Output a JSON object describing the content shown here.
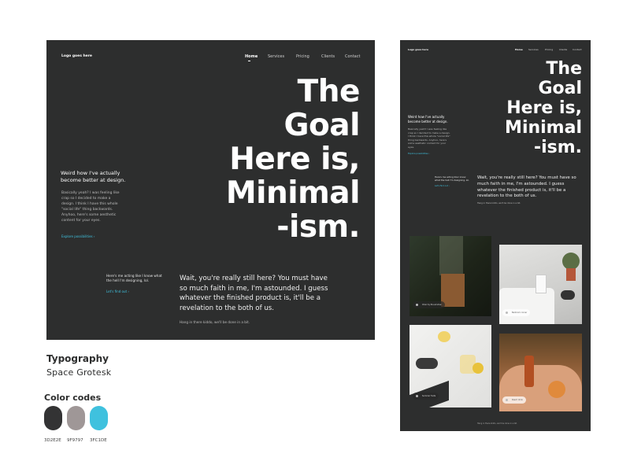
{
  "desktop": {
    "logo": "Logo goes here",
    "nav": [
      "Home",
      "Services",
      "Pricing",
      "Clients",
      "Contact"
    ],
    "hero": [
      "The",
      "Goal",
      "Here is,",
      "Minimal",
      "-ism."
    ],
    "lead": "Weird how I've actually become better at design.",
    "body": "Basically yeah? I was feeling like crap so I decided to make a design. I think I have this whole \"social life\" thing backwards. Anyhoo, here's some aesthetic content for your eyes.",
    "link1": "Explore possibilities ›",
    "small": "Here's me acting like I know what the hell I'm designing, lol.",
    "link2": "Let's find out ›",
    "wait": "Wait, you're really still here? You must have so much faith in me, I'm astounded. I guess whatever the finished product is, it'll be a revelation to the both of us.",
    "foot": "Hang in there kiddo, we'll be done in a bit."
  },
  "mobile": {
    "logo": "Logo goes here",
    "nav": [
      "Home",
      "Services",
      "Pricing",
      "Clients",
      "Contact"
    ],
    "hero": [
      "The",
      "Goal",
      "Here is,",
      "Minimal",
      "-ism."
    ],
    "lead": "Weird how I've actually become better at design.",
    "body": "Basically yeah? I was feeling like crap so I decided to make a design. I think I have this whole \"social life\" thing backwards. Anyhoo, here's some aesthetic content for your eyes.",
    "link1": "Explore possibilities ›",
    "small": "Here's me acting like I know what the hell I'm designing, lol.",
    "link2": "Let's find out ›",
    "wait": "Wait, you're really still here? You must have so much faith in me, I'm astounded. I guess whatever the finished product is, it'll be a revelation to the both of us.",
    "foot": "Hang in there kiddo, we'll be done in a bit.",
    "photo_tags": [
      "Chair by the window",
      "Bedroom corner",
      "Summer fruits",
      "Peach drink"
    ],
    "footer": "Hang in there kiddo, we'll be done in a bit."
  },
  "typography": {
    "label": "Typography",
    "font": "Space Grotesk"
  },
  "colors": {
    "label": "Color codes",
    "swatches": [
      {
        "code": "3D2E2E",
        "hex": "#333334"
      },
      {
        "code": "9F9797",
        "hex": "#9f9797"
      },
      {
        "code": "3FC1DE",
        "hex": "#3fc1de"
      }
    ]
  }
}
